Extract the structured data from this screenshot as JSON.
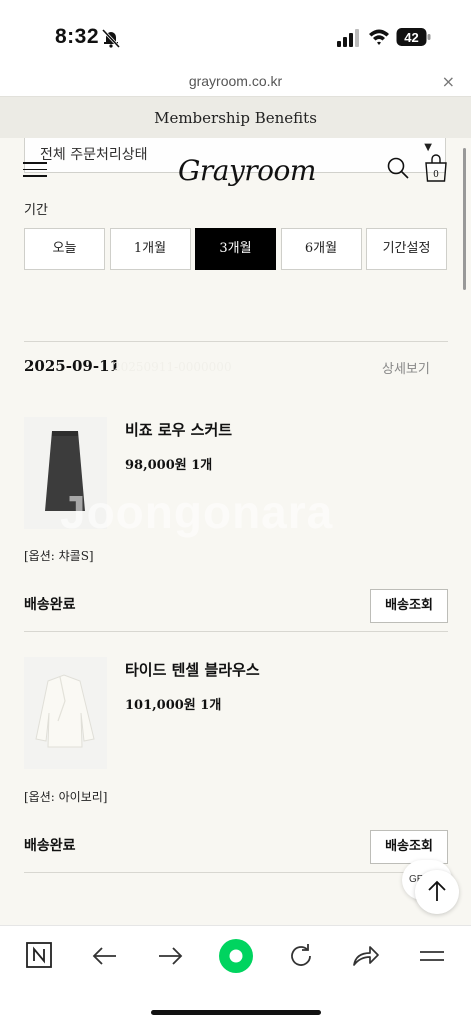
{
  "status_bar": {
    "time": "8:32",
    "battery": "42"
  },
  "browser": {
    "url": "grayroom.co.kr",
    "close_glyph": "×"
  },
  "banner": {
    "text": "Membership Benefits"
  },
  "header": {
    "logo": "Grayroom",
    "status_select": "전체 주문처리상태"
  },
  "period": {
    "label": "기간",
    "options": [
      "오늘",
      "1개월",
      "3개월",
      "6개월",
      "기간설정"
    ],
    "selected": "3개월"
  },
  "order": {
    "date": "2025-09-11",
    "order_number": "20250911-0000000",
    "detail_link": "상세보기",
    "items": [
      {
        "name": "비죠 로우 스커트",
        "price": "98,000원",
        "qty": "1개",
        "option": "[옵션: 챠콜S]",
        "status": "배송완료",
        "track_label": "배송조회"
      },
      {
        "name": "타이드 텐셀 블라우스",
        "price": "101,000원",
        "qty": "1개",
        "option": "[옵션: 아이보리]",
        "status": "배송완료",
        "track_label": "배송조회"
      }
    ]
  },
  "watermark": "Joongonara",
  "floating": {
    "gr_badge": "GR",
    "scroll_top": "arrow-up-icon"
  },
  "icons": [
    "bell-mute-icon",
    "signal-icon",
    "wifi-icon",
    "battery-icon",
    "menu-icon",
    "search-icon",
    "bag-icon",
    "n-logo-icon",
    "back-arrow-icon",
    "forward-arrow-icon",
    "home-dot-icon",
    "reload-icon",
    "share-icon",
    "hamburger-menu-icon"
  ],
  "colors": {
    "page_bg": "#f8f7f2",
    "active": "#000000",
    "accent_green": "#00d45f"
  }
}
